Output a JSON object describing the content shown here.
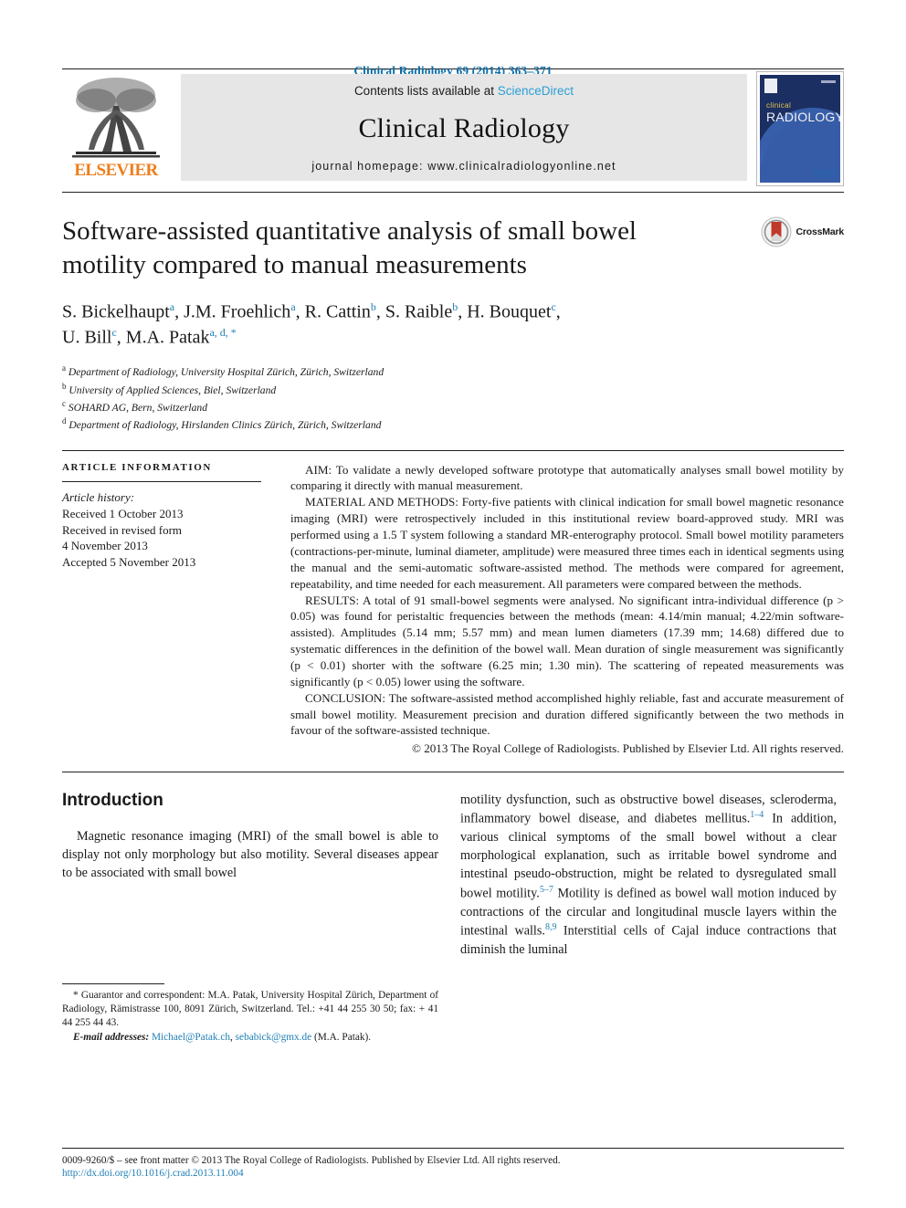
{
  "running_head": "Clinical Radiology 69 (2014) 363–371",
  "banner": {
    "publisher_name": "ELSEVIER",
    "contents_prefix": "Contents lists available at ",
    "contents_link": "ScienceDirect",
    "journal_name": "Clinical Radiology",
    "homepage": "journal homepage: www.clinicalradiologyonline.net",
    "cover": {
      "line1": "clinical",
      "line2": "RADIOLOGY"
    }
  },
  "crossmark": {
    "label": "CrossMark"
  },
  "article": {
    "title": "Software-assisted quantitative analysis of small bowel motility compared to manual measurements",
    "authors_line1": "S. Bickelhaupt a, J.M. Froehlich a, R. Cattin b, S. Raible b, H. Bouquet c,",
    "authors_line2": "U. Bill c, M.A. Patak a, d, *",
    "authors": [
      {
        "name": "S. Bickelhaupt",
        "marks": "a",
        "sep": ", "
      },
      {
        "name": "J.M. Froehlich",
        "marks": "a",
        "sep": ", "
      },
      {
        "name": "R. Cattin",
        "marks": "b",
        "sep": ", "
      },
      {
        "name": "S. Raible",
        "marks": "b",
        "sep": ", "
      },
      {
        "name": "H. Bouquet",
        "marks": "c",
        "sep": ","
      },
      {
        "name": "U. Bill",
        "marks": "c",
        "sep": ", "
      },
      {
        "name": "M.A. Patak",
        "marks": "a, d, *",
        "sep": ""
      }
    ],
    "affiliations": [
      {
        "mark": "a",
        "text": "Department of Radiology, University Hospital Zürich, Zürich, Switzerland"
      },
      {
        "mark": "b",
        "text": "University of Applied Sciences, Biel, Switzerland"
      },
      {
        "mark": "c",
        "text": "SOHARD AG, Bern, Switzerland"
      },
      {
        "mark": "d",
        "text": "Department of Radiology, Hirslanden Clinics Zürich, Zürich, Switzerland"
      }
    ]
  },
  "article_info": {
    "heading": "ARTICLE INFORMATION",
    "history_label": "Article history:",
    "history": [
      "Received 1 October 2013",
      "Received in revised form",
      "4 November 2013",
      "Accepted 5 November 2013"
    ]
  },
  "abstract": {
    "aim": "AIM: To validate a newly developed software prototype that automatically analyses small bowel motility by comparing it directly with manual measurement.",
    "methods": "MATERIAL AND METHODS: Forty-five patients with clinical indication for small bowel magnetic resonance imaging (MRI) were retrospectively included in this institutional review board-approved study. MRI was performed using a 1.5 T system following a standard MR-enterography protocol. Small bowel motility parameters (contractions-per-minute, luminal diameter, amplitude) were measured three times each in identical segments using the manual and the semi-automatic software-assisted method. The methods were compared for agreement, repeatability, and time needed for each measurement. All parameters were compared between the methods.",
    "results": "RESULTS: A total of 91 small-bowel segments were analysed. No significant intra-individual difference (p > 0.05) was found for peristaltic frequencies between the methods (mean: 4.14/min manual; 4.22/min software-assisted). Amplitudes (5.14 mm; 5.57 mm) and mean lumen diameters (17.39 mm; 14.68) differed due to systematic differences in the definition of the bowel wall. Mean duration of single measurement was significantly (p < 0.01) shorter with the software (6.25 min; 1.30 min). The scattering of repeated measurements was significantly (p < 0.05) lower using the software.",
    "conclusion": "CONCLUSION: The software-assisted method accomplished highly reliable, fast and accurate measurement of small bowel motility. Measurement precision and duration differed significantly between the two methods in favour of the software-assisted technique.",
    "copyright": "© 2013 The Royal College of Radiologists. Published by Elsevier Ltd. All rights reserved."
  },
  "introduction": {
    "heading": "Introduction",
    "col_left": "Magnetic resonance imaging (MRI) of the small bowel is able to display not only morphology but also motility. Several diseases appear to be associated with small bowel",
    "col_right_part1": "motility dysfunction, such as obstructive bowel diseases, scleroderma, inflammatory bowel disease, and diabetes mellitus.",
    "ref1": "1–4",
    "col_right_part2": " In addition, various clinical symptoms of the small bowel without a clear morphological explanation, such as irritable bowel syndrome and intestinal pseudo-obstruction, might be related to dysregulated small bowel motility.",
    "ref2": "5–7",
    "col_right_part3": " Motility is defined as bowel wall motion induced by contractions of the circular and longitudinal muscle layers within the intestinal walls.",
    "ref3": "8,9",
    "col_right_part4": " Interstitial cells of Cajal induce contractions that diminish the luminal"
  },
  "footnote": {
    "corresponding": "* Guarantor and correspondent: M.A. Patak, University Hospital Zürich, Department of Radiology, Rämistrasse 100, 8091 Zürich, Switzerland. Tel.: +41 44 255 30 50; fax: + 41 44 255 44 43.",
    "email_label": "E-mail addresses:",
    "email1": "Michael@Patak.ch",
    "email2": "sebabick@gmx.de",
    "email_suffix": " (M.A. Patak)."
  },
  "page_footer": {
    "issn_line": "0009-9260/$ – see front matter © 2013 The Royal College of Radiologists. Published by Elsevier Ltd. All rights reserved.",
    "doi": "http://dx.doi.org/10.1016/j.crad.2013.11.004"
  },
  "colors": {
    "accent_blue": "#1f7fb5",
    "link_blue": "#2a9fd6",
    "elsevier_orange": "#ef7d1a",
    "crossmark_red": "#c0392b"
  }
}
